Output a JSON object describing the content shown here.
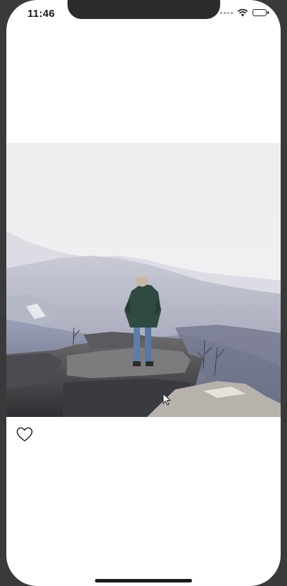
{
  "status_bar": {
    "time": "11:46"
  },
  "post": {
    "image_description_icon": "landscape-photo",
    "liked": false,
    "like_icon": "heart-outline-icon"
  },
  "colors": {
    "background": "#ffffff",
    "bezel": "#3a3a3a"
  }
}
